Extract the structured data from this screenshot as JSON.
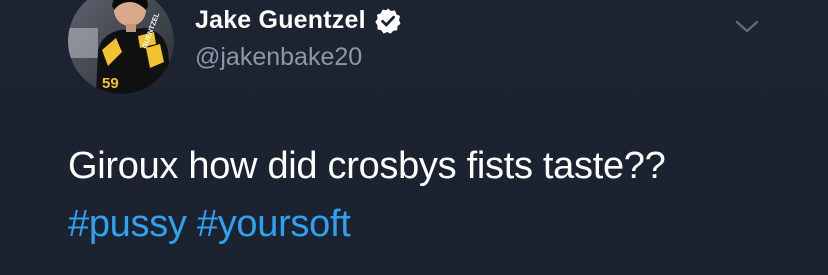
{
  "user": {
    "display_name": "Jake Guentzel",
    "handle": "@jakenbake20",
    "verified": true,
    "avatar": {
      "icon": "profile-photo-hockey-player",
      "jersey_number": "59",
      "jersey_name": "GUENTZEL"
    }
  },
  "tweet": {
    "text": "Giroux how did crosbys fists taste??",
    "hashtags": [
      "#pussy",
      "#yoursoft"
    ]
  },
  "menu": {
    "icon": "chevron-down-icon"
  },
  "colors": {
    "background": "#1c2330",
    "handle": "#8b98a8",
    "hashtag": "#2ea1f2",
    "verified_badge": "#ffffff"
  }
}
